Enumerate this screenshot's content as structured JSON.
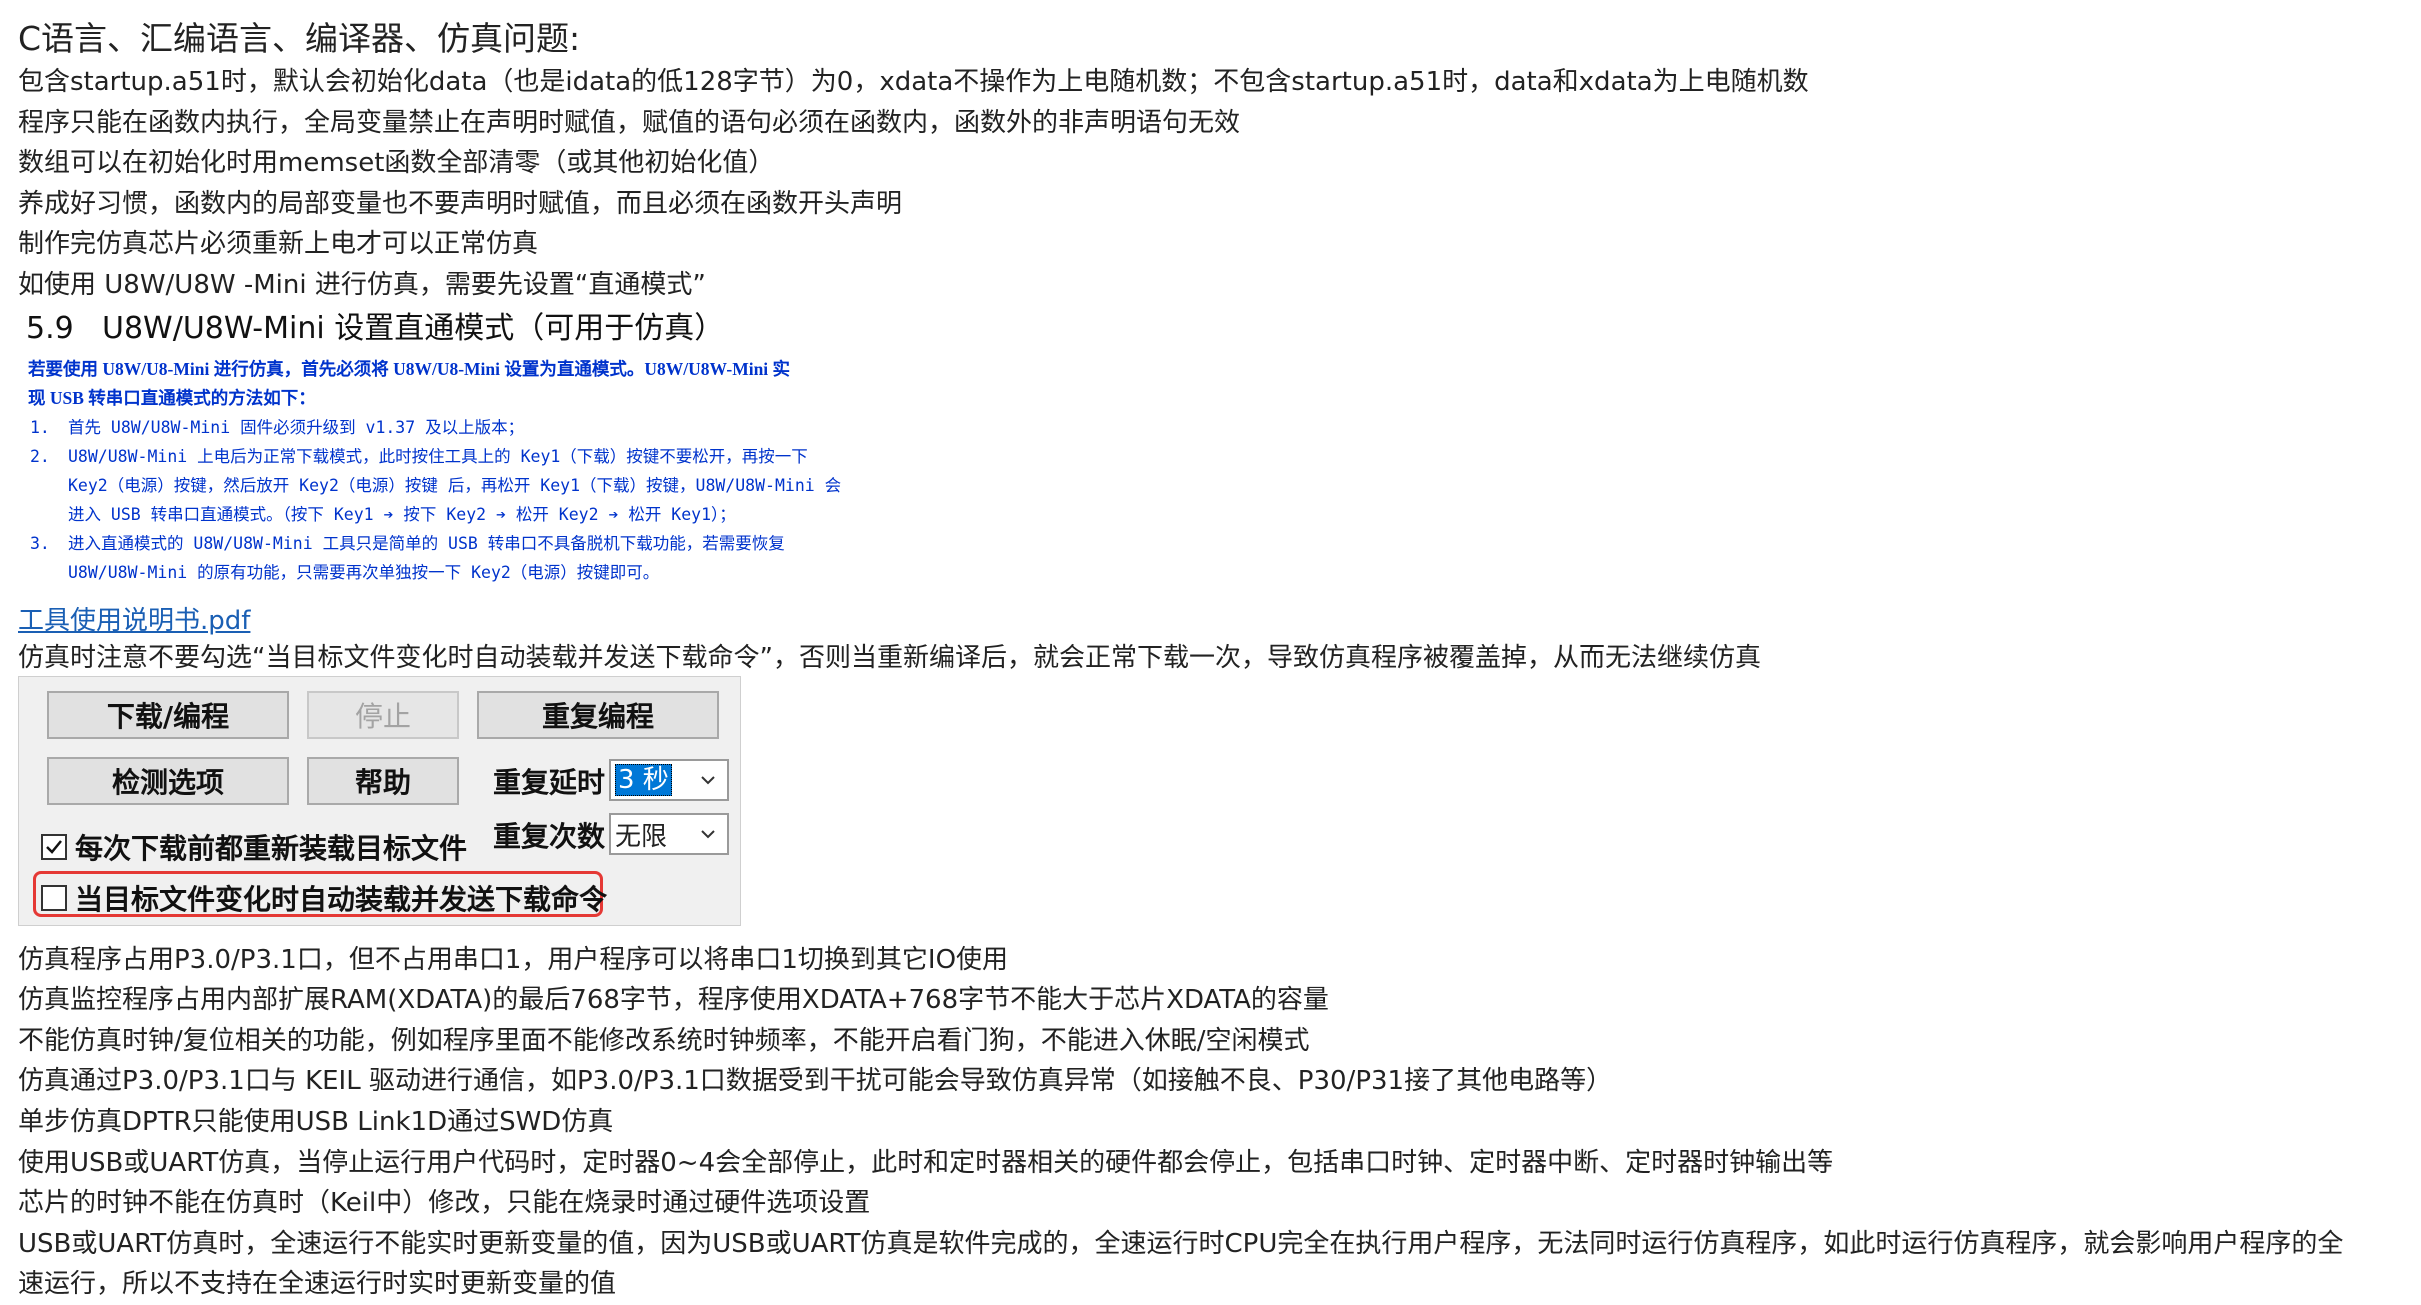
{
  "title": "C语言、汇编语言、编译器、仿真问题:",
  "lines_top": [
    "包含startup.a51时，默认会初始化data（也是idata的低128字节）为0，xdata不操作为上电随机数；不包含startup.a51时，data和xdata为上电随机数",
    "程序只能在函数内执行，全局变量禁止在声明时赋值，赋值的语句必须在函数内，函数外的非声明语句无效",
    "数组可以在初始化时用memset函数全部清零（或其他初始化值）",
    "养成好习惯，函数内的局部变量也不要声明时赋值，而且必须在函数开头声明",
    "制作完仿真芯片必须重新上电才可以正常仿真",
    "如使用 U8W/U8W -Mini 进行仿真，需要先设置“直通模式”"
  ],
  "section": {
    "number": "5.9",
    "title": "U8W/U8W-Mini 设置直通模式（可用于仿真）"
  },
  "blue_box": {
    "intro": [
      "若要使用 U8W/U8-Mini 进行仿真，首先必须将 U8W/U8-Mini 设置为直通模式。U8W/U8W-Mini 实",
      "现 USB 转串口直通模式的方法如下："
    ],
    "items": [
      {
        "n": "1.",
        "lines": [
          "首先 U8W/U8W-Mini 固件必须升级到 v1.37 及以上版本；"
        ]
      },
      {
        "n": "2.",
        "lines": [
          "U8W/U8W-Mini 上电后为正常下载模式，此时按住工具上的 Key1（下载）按键不要松开，再按一下",
          "Key2（电源）按键，然后放开 Key2（电源）按键 后，再松开 Key1（下载）按键，U8W/U8W-Mini 会",
          "进入 USB 转串口直通模式。（按下 Key1 ➔ 按下 Key2 ➔ 松开 Key2 ➔ 松开 Key1）；"
        ]
      },
      {
        "n": "3.",
        "lines": [
          "进入直通模式的 U8W/U8W-Mini 工具只是简单的 USB 转串口不具备脱机下载功能，若需要恢复",
          "U8W/U8W-Mini 的原有功能，只需要再次单独按一下 Key2（电源）按键即可。"
        ]
      }
    ]
  },
  "link_text": "工具使用说明书.pdf",
  "warning_line": "仿真时注意不要勾选“当目标文件变化时自动装载并发送下载命令”，否则当重新编译后，就会正常下载一次，导致仿真程序被覆盖掉，从而无法继续仿真",
  "panel": {
    "download_btn": "下载/编程",
    "stop_btn": "停止",
    "repeat_btn": "重复编程",
    "check_btn": "检测选项",
    "help_btn": "帮助",
    "delay_label": "重复延时",
    "delay_value": "3 秒",
    "count_label": "重复次数",
    "count_value": "无限",
    "reload_check": "每次下载前都重新装载目标文件",
    "auto_check": "当目标文件变化时自动装载并发送下载命令",
    "reload_checked": true,
    "auto_checked": false
  },
  "lines_bottom": [
    "仿真程序占用P3.0/P3.1口，但不占用串口1，用户程序可以将串口1切换到其它IO使用",
    "仿真监控程序占用内部扩展RAM(XDATA)的最后768字节，程序使用XDATA+768字节不能大于芯片XDATA的容量",
    "不能仿真时钟/复位相关的功能，例如程序里面不能修改系统时钟频率，不能开启看门狗，不能进入休眠/空闲模式",
    "仿真通过P3.0/P3.1口与 KEIL 驱动进行通信，如P3.0/P3.1口数据受到干扰可能会导致仿真异常（如接触不良、P30/P31接了其他电路等）",
    "单步仿真DPTR只能使用USB Link1D通过SWD仿真",
    "使用USB或UART仿真，当停止运行用户代码时，定时器0~4会全部停止，此时和定时器相关的硬件都会停止，包括串口时钟、定时器中断、定时器时钟输出等",
    "芯片的时钟不能在仿真时（Keil中）修改，只能在烧录时通过硬件选项设置",
    "USB或UART仿真时，全速运行不能实时更新变量的值，因为USB或UART仿真是软件完成的，全速运行时CPU完全在执行用户程序，无法同时运行仿真程序，如此时运行仿真程序，就会影响用户程序的全",
    "速运行，所以不支持在全速运行时实时更新变量的值"
  ]
}
